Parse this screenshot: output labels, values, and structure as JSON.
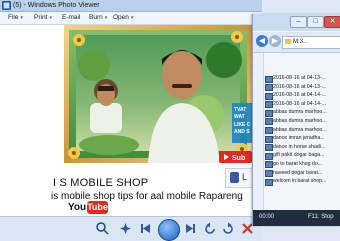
{
  "window": {
    "title": "(5) - Windows Photo Viewer"
  },
  "menu": [
    {
      "label": "File"
    },
    {
      "label": "Print"
    },
    {
      "label": "E-mail"
    },
    {
      "label": "Burn"
    },
    {
      "label": "Open"
    }
  ],
  "overlay": {
    "shop_name": "I S MOBILE SHOP",
    "tagline": "is mobile shop tips for aal mobile Rapareng",
    "youtube_you": "You",
    "youtube_tube": "Tube",
    "subscribe": "Sub",
    "promo_lines": [
      "TVAT",
      "WAT",
      "LIKE C",
      "AND S"
    ],
    "like": "L"
  },
  "explorer": {
    "address": "M:3...",
    "files": [
      "2016-08-16 at 04-13-...",
      "2016-08-16 at 04-13-...",
      "2016-08-16 at 04-14-...",
      "2016-08-16 at 04-14-...",
      "abbas dumra marhoo...",
      "abbas dumra marhoo...",
      "abbas dumra marhoo...",
      "dance imran jeradha...",
      "dance in horse shadi...",
      "gift pakit dogar baga...",
      "go to barat khog do...",
      "naveed dogar barat...",
      "welcom in barat shop..."
    ],
    "status_time": "00:00",
    "status_fs": "F11: Stop"
  },
  "colors": {
    "titlebar": "#b9d1ea",
    "accent": "#1e5fbf",
    "youtube_red": "#e02a1f",
    "status_bg": "#1f2d3d"
  }
}
